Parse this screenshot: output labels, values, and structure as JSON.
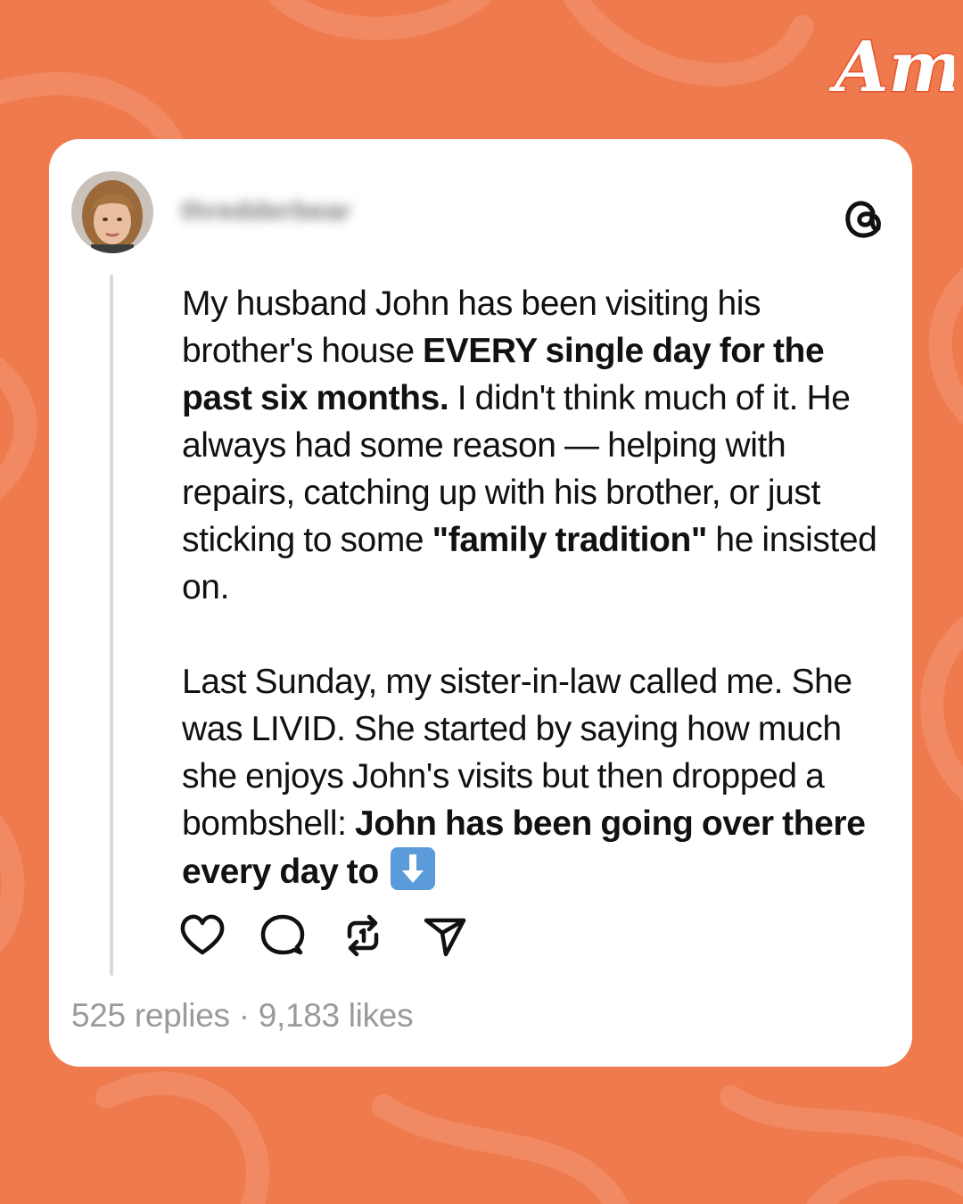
{
  "brand": {
    "logo_text": "Am"
  },
  "post": {
    "username": "thredderbear",
    "paragraphs": [
      [
        {
          "text": "My husband John has been visiting his brother's house ",
          "bold": false
        },
        {
          "text": "EVERY single day for the past six months.",
          "bold": true
        },
        {
          "text": " I didn't think much of it. He always had some reason — helping with repairs, catching up with his brother, or just sticking to some ",
          "bold": false
        },
        {
          "text": "\"family tradition\"",
          "bold": true
        },
        {
          "text": " he insisted on.",
          "bold": false
        }
      ],
      [
        {
          "text": "Last Sunday, my sister-in-law called me. She was LIVID. She started by saying how much she enjoys John's visits but then dropped a bombshell: ",
          "bold": false
        },
        {
          "text": "John has been going over there every day to",
          "bold": true
        }
      ]
    ],
    "trailing_icon": "down-arrow-emoji",
    "stats": "525 replies · 9,183 likes"
  },
  "icons": {
    "app": "threads-icon",
    "actions": [
      "heart-icon",
      "comment-icon",
      "repost-icon",
      "share-icon"
    ]
  },
  "colors": {
    "background": "#ef7a4e",
    "card": "#ffffff",
    "text": "#111111",
    "muted": "#9a9a9a",
    "thread_line": "#d9d9d9"
  }
}
